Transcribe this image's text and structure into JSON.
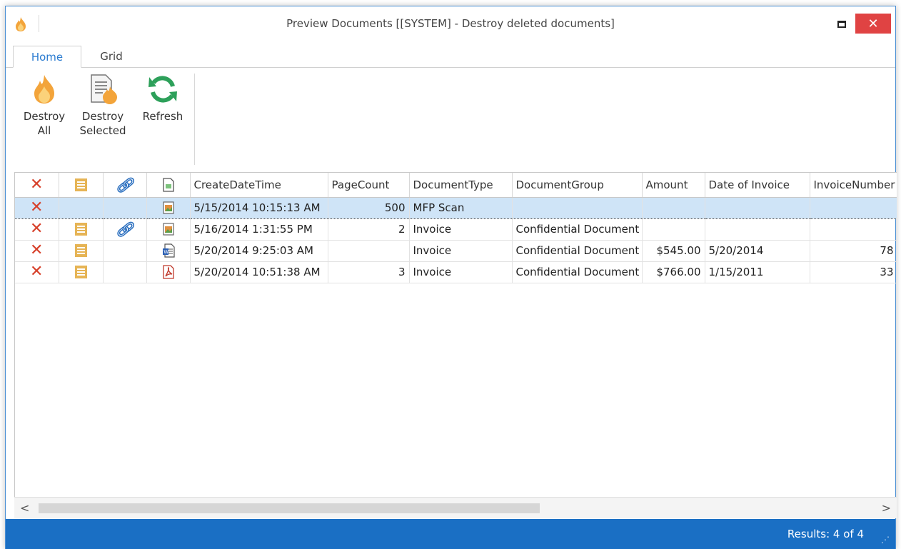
{
  "window": {
    "title": "Preview Documents [[SYSTEM] - Destroy deleted documents]",
    "close_label": "✕"
  },
  "tabs": [
    {
      "label": "Home",
      "active": true
    },
    {
      "label": "Grid",
      "active": false
    }
  ],
  "ribbon": {
    "destroy_all": {
      "line1": "Destroy",
      "line2": "All"
    },
    "destroy_selected": {
      "line1": "Destroy",
      "line2": "Selected"
    },
    "refresh": {
      "label": "Refresh"
    }
  },
  "grid": {
    "columns": [
      "",
      "",
      "",
      "",
      "CreateDateTime",
      "PageCount",
      "DocumentType",
      "DocumentGroup",
      "Amount",
      "Date of Invoice",
      "InvoiceNumber"
    ],
    "rows": [
      {
        "has_doc": false,
        "has_link": false,
        "file_type": "image",
        "create": "5/15/2014 10:15:13 AM",
        "pages": "500",
        "type": "MFP Scan",
        "group": "",
        "amount": "",
        "date": "",
        "invoice": "",
        "selected": true
      },
      {
        "has_doc": true,
        "has_link": true,
        "file_type": "image",
        "create": "5/16/2014 1:31:55 PM",
        "pages": "2",
        "type": "Invoice",
        "group": "Confidential Document",
        "amount": "",
        "date": "",
        "invoice": "",
        "selected": false
      },
      {
        "has_doc": true,
        "has_link": false,
        "file_type": "word",
        "create": "5/20/2014 9:25:03 AM",
        "pages": "",
        "type": "Invoice",
        "group": "Confidential Document",
        "amount": "$545.00",
        "date": "5/20/2014",
        "invoice": "78",
        "selected": false
      },
      {
        "has_doc": true,
        "has_link": false,
        "file_type": "pdf",
        "create": "5/20/2014 10:51:38 AM",
        "pages": "3",
        "type": "Invoice",
        "group": "Confidential Document",
        "amount": "$766.00",
        "date": "1/15/2011",
        "invoice": "33",
        "selected": false
      }
    ]
  },
  "scrollbar": {
    "left": "<",
    "right": ">"
  },
  "status": {
    "results": "Results: 4 of 4"
  },
  "colors": {
    "accent": "#1a6fc4",
    "close": "#e04343",
    "delete": "#d7402a",
    "doc": "#e6b455",
    "refresh": "#2da05a"
  }
}
